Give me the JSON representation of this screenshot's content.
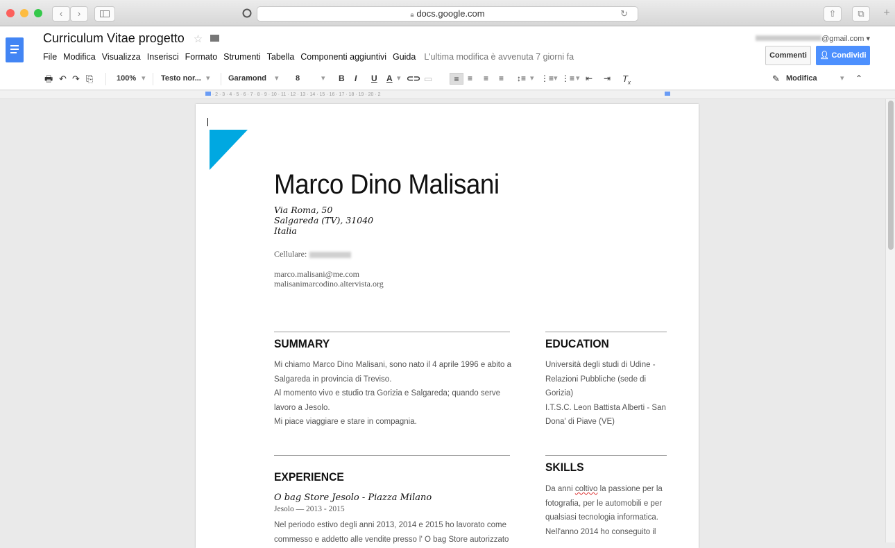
{
  "browser": {
    "url": "docs.google.com",
    "nav_back": "‹",
    "nav_forward": "›",
    "reload": "↻",
    "share": "⇧",
    "tabs": "⧉",
    "new_tab": "+"
  },
  "docs": {
    "title": "Curriculum Vitae progetto",
    "menu": [
      "File",
      "Modifica",
      "Visualizza",
      "Inserisci",
      "Formato",
      "Strumenti",
      "Tabella",
      "Componenti aggiuntivi",
      "Guida"
    ],
    "last_modified": "L'ultima modifica è avvenuta 7 giorni fa",
    "account_email": "@gmail.com",
    "comments_label": "Commenti",
    "share_label": "Condividi"
  },
  "toolbar": {
    "zoom": "100%",
    "style": "Testo nor...",
    "font": "Garamond",
    "size": "8",
    "bold": "B",
    "italic": "I",
    "underline": "U",
    "color": "A",
    "mode": "Modifica"
  },
  "ruler_text": "1 · 2 · 3 · 4 · 5 · 6 · 7 · 8 · 9 · 10 · 11 · 12 · 13 · 14 · 15 · 16 · 17 · 18 · 19 · 20 · 2",
  "cv": {
    "name": "Marco Dino Malisani",
    "address": [
      "Via Roma, 50",
      "Salgareda (TV), 31040",
      "Italia"
    ],
    "phone_label": "Cellulare:",
    "email": "marco.malisani@me.com",
    "website": "malisanimarcodino.altervista.org",
    "summary_title": "SUMMARY",
    "summary": [
      "Mi chiamo Marco Dino Malisani, sono nato il 4 aprile 1996 e abito a",
      "Salgareda in provincia di Treviso.",
      "Al momento vivo e studio tra Gorizia e Salgareda; quando serve",
      "lavoro a Jesolo.",
      "Mi piace viaggiare e stare in compagnia."
    ],
    "education_title": "EDUCATION",
    "education": [
      "Università degli studi di Udine -",
      "Relazioni Pubbliche (sede di",
      "Gorizia)",
      "I.T.S.C. Leon Battista Alberti - San",
      "Dona' di Piave (VE)"
    ],
    "experience_title": "EXPERIENCE",
    "job_title": "O bag Store Jesolo - Piazza Milano",
    "job_meta": "Jesolo — 2013 - 2015",
    "job_desc": [
      "Nel periodo estivo degli anni 2013, 2014 e 2015 ho lavorato come",
      "commesso e addetto alle vendite presso l' O bag Store autorizzato"
    ],
    "skills_title": "SKILLS",
    "skills_pre": "Da anni ",
    "skills_word": "coltivo",
    "skills_post": " la passione per la",
    "skills": [
      "fotografia, per le automobili e per",
      "qualsiasi tecnologia informatica.",
      "Nell'anno 2014 ho conseguito il"
    ]
  },
  "colors": {
    "accent_triangle": "#00a8e1",
    "docs_blue": "#4285f4",
    "share_blue": "#4d90fe"
  }
}
